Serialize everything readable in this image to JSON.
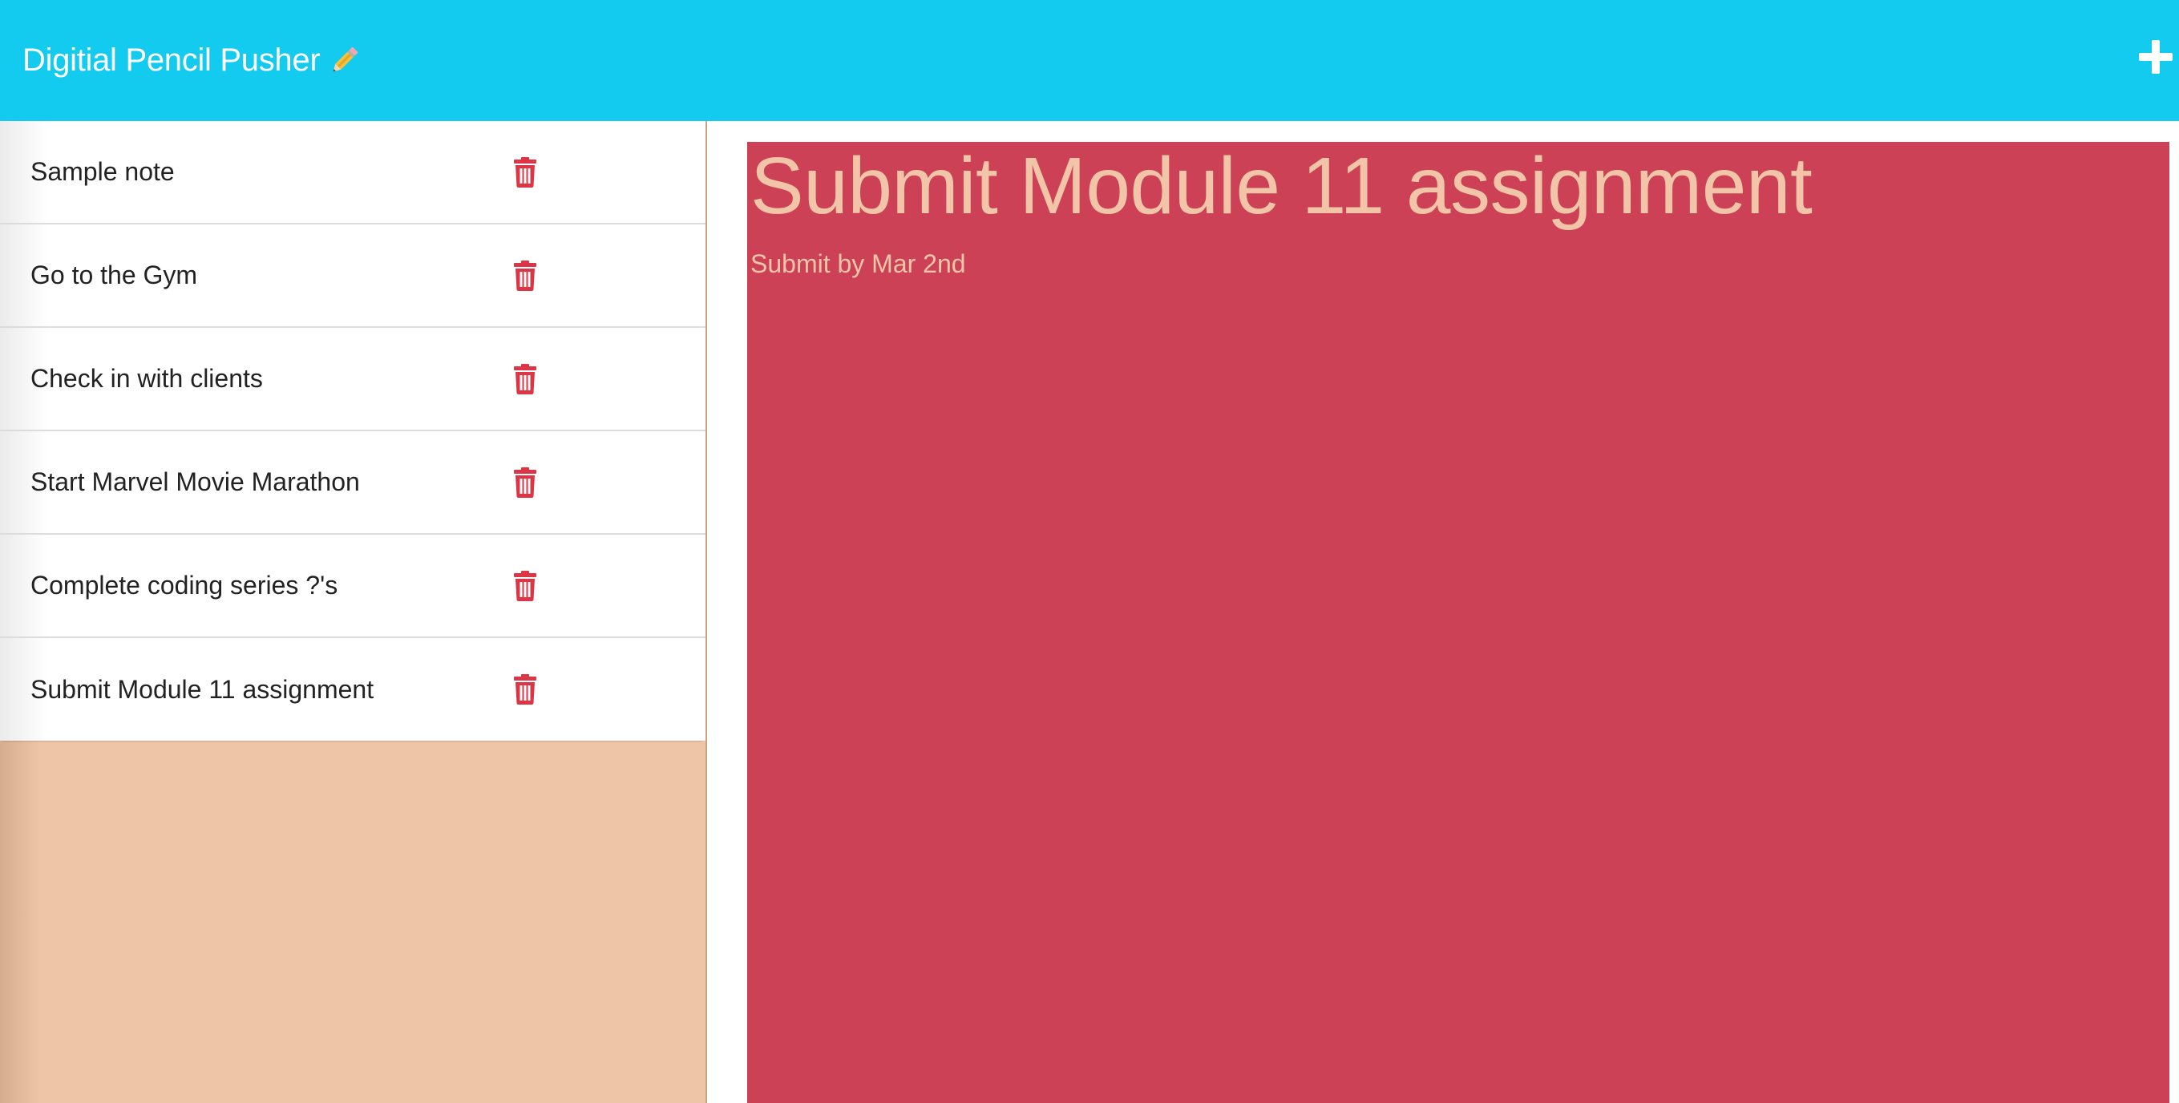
{
  "header": {
    "brand": "Digitial Pencil Pusher",
    "brand_icon": "pencil-icon",
    "add_icon": "plus-icon",
    "background_color": "#12cbef"
  },
  "sidebar": {
    "background_color": "#efc5a8",
    "notes": [
      {
        "title": "Sample note",
        "delete_icon": "trash-icon"
      },
      {
        "title": "Go to the Gym",
        "delete_icon": "trash-icon"
      },
      {
        "title": "Check in with clients",
        "delete_icon": "trash-icon"
      },
      {
        "title": "Start Marvel Movie Marathon",
        "delete_icon": "trash-icon"
      },
      {
        "title": "Complete coding series ?'s",
        "delete_icon": "trash-icon"
      },
      {
        "title": "Submit Module 11 assignment",
        "delete_icon": "trash-icon"
      }
    ]
  },
  "editor": {
    "title": "Submit Module 11 assignment",
    "body": "Submit by Mar 2nd",
    "background_color": "#cc4155",
    "text_color": "#f2c5a9"
  },
  "colors": {
    "delete_icon": "#dc3545"
  }
}
